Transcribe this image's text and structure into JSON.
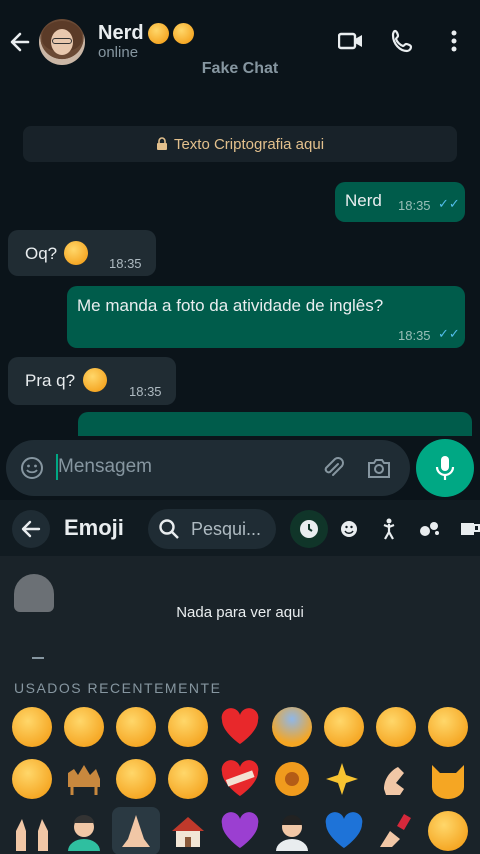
{
  "header": {
    "contact_name": "Nerd",
    "status": "online",
    "banner": "Fake Chat",
    "name_emojis": [
      "nerd-face-emoji",
      "unamused-face-emoji"
    ]
  },
  "chat": {
    "encryption_notice": "Texto Criptografia aqui",
    "messages": [
      {
        "dir": "out",
        "text": "Nerd",
        "time": "18:35",
        "read": true
      },
      {
        "dir": "in",
        "text": "Oq?",
        "emoji": "nerd-face-emoji",
        "time": "18:35"
      },
      {
        "dir": "out",
        "text": "Me manda a foto da atividade de inglês?",
        "time": "18:35",
        "read": true
      },
      {
        "dir": "in",
        "text": "Pra q?",
        "emoji": "raised-eyebrow-emoji",
        "time": "18:35"
      }
    ]
  },
  "input": {
    "placeholder": "Mensagem"
  },
  "emoji_panel": {
    "title": "Emoji",
    "search_placeholder": "Pesqui...",
    "empty_text": "Nada para ver aqui",
    "section_title": "USADOS RECENTEMENTE",
    "categories": [
      "recent-icon",
      "smiley-icon",
      "person-icon",
      "animals-icon",
      "food-icon"
    ],
    "recent_emojis": [
      [
        "grinning",
        "expressionless",
        "hushed",
        "unamused",
        "red-heart",
        "scream",
        "raised-eyebrow",
        "rolling-eyes",
        "nerd"
      ],
      [
        "kissing-heart",
        "camel",
        "angry",
        "monocle",
        "mending-heart",
        "flower",
        "sparkles",
        "pinching-hand",
        "cat-face"
      ],
      [
        "raising-hands",
        "man",
        "praying-hands",
        "house",
        "purple-heart",
        "woman",
        "blue-heart",
        "nail-polish",
        "shy-face"
      ]
    ]
  },
  "colors": {
    "background": "#0b141a",
    "outgoing_bubble": "#005c4b",
    "incoming_bubble": "#202c33",
    "accent": "#00a884",
    "read_ticks": "#53bdeb"
  }
}
